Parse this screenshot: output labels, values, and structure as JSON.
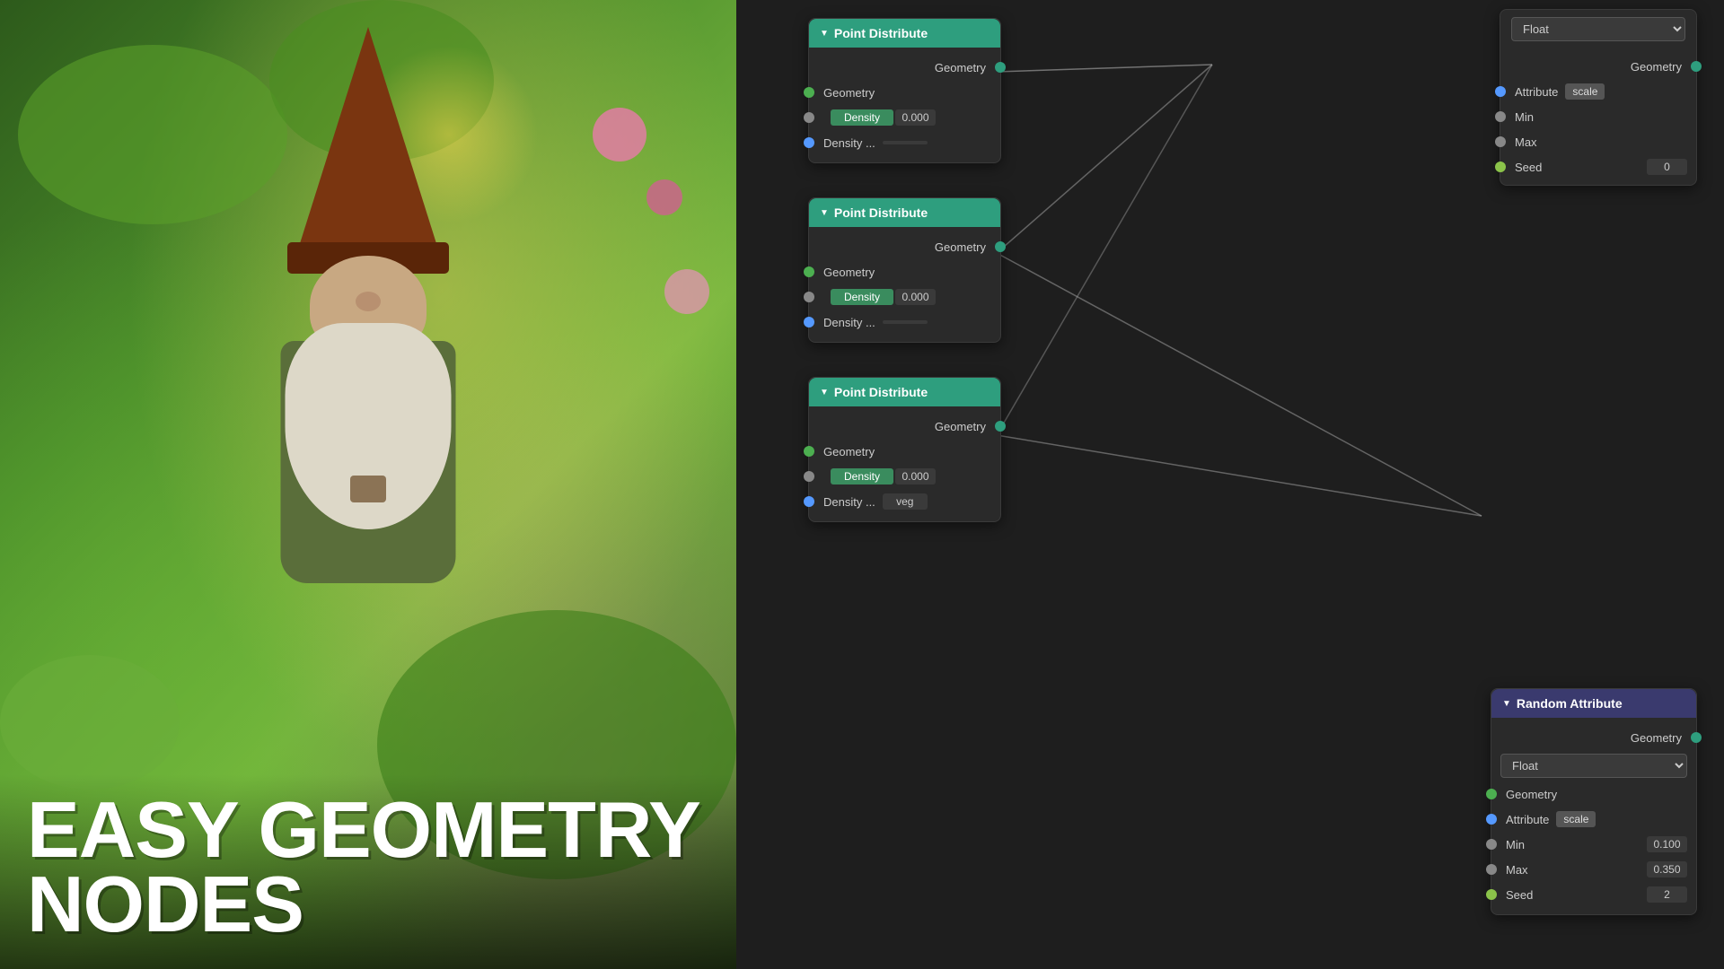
{
  "photo": {
    "title_line1": "EASY GEOMETRY",
    "title_line2": "NODES"
  },
  "nodes": {
    "float_node": {
      "title": "Float",
      "rows": [
        {
          "label": "Geometry",
          "socket": "teal",
          "side": "input"
        },
        {
          "label": "Attribute",
          "socket": "blue",
          "side": "input",
          "badge": "scale"
        },
        {
          "label": "Min",
          "socket": "gray",
          "side": "input"
        },
        {
          "label": "Max",
          "socket": "gray",
          "side": "input"
        },
        {
          "label": "Seed",
          "socket": "light-green",
          "side": "input",
          "value": "0"
        }
      ]
    },
    "point_distribute_1": {
      "title": "Point Distribute",
      "output_row": "Geometry",
      "rows": [
        {
          "label": "Geometry",
          "socket": "green",
          "side": "input"
        },
        {
          "label": "Density",
          "field_label": "Density",
          "value": "0.000",
          "socket": "gray",
          "side": "input"
        },
        {
          "label": "Density ...",
          "field_text": "",
          "socket": "blue",
          "side": "input"
        }
      ]
    },
    "point_distribute_2": {
      "title": "Point Distribute",
      "output_row": "Geometry",
      "rows": [
        {
          "label": "Geometry",
          "socket": "green",
          "side": "input"
        },
        {
          "label": "Density",
          "field_label": "Density",
          "value": "0.000",
          "socket": "gray",
          "side": "input"
        },
        {
          "label": "Density ...",
          "field_text": "",
          "socket": "blue",
          "side": "input"
        }
      ]
    },
    "point_distribute_3": {
      "title": "Point Distribute",
      "output_row": "Geometry",
      "rows": [
        {
          "label": "Geometry",
          "socket": "green",
          "side": "input"
        },
        {
          "label": "Density",
          "field_label": "Density",
          "value": "0.000",
          "socket": "gray",
          "side": "input"
        },
        {
          "label": "Density ...",
          "field_text": "veg",
          "socket": "blue",
          "side": "input"
        }
      ]
    },
    "random_attribute": {
      "title": "Random Attribute",
      "output_row": "Geometry",
      "type_select": "Float",
      "rows": [
        {
          "label": "Geometry",
          "socket": "green",
          "side": "input"
        },
        {
          "label": "Attribute",
          "socket": "blue",
          "side": "input",
          "badge": "scale"
        },
        {
          "label": "Min",
          "value": "0.100",
          "side": "input"
        },
        {
          "label": "Max",
          "value": "0.350",
          "side": "input"
        },
        {
          "label": "Seed",
          "value": "2",
          "side": "input"
        }
      ]
    }
  }
}
